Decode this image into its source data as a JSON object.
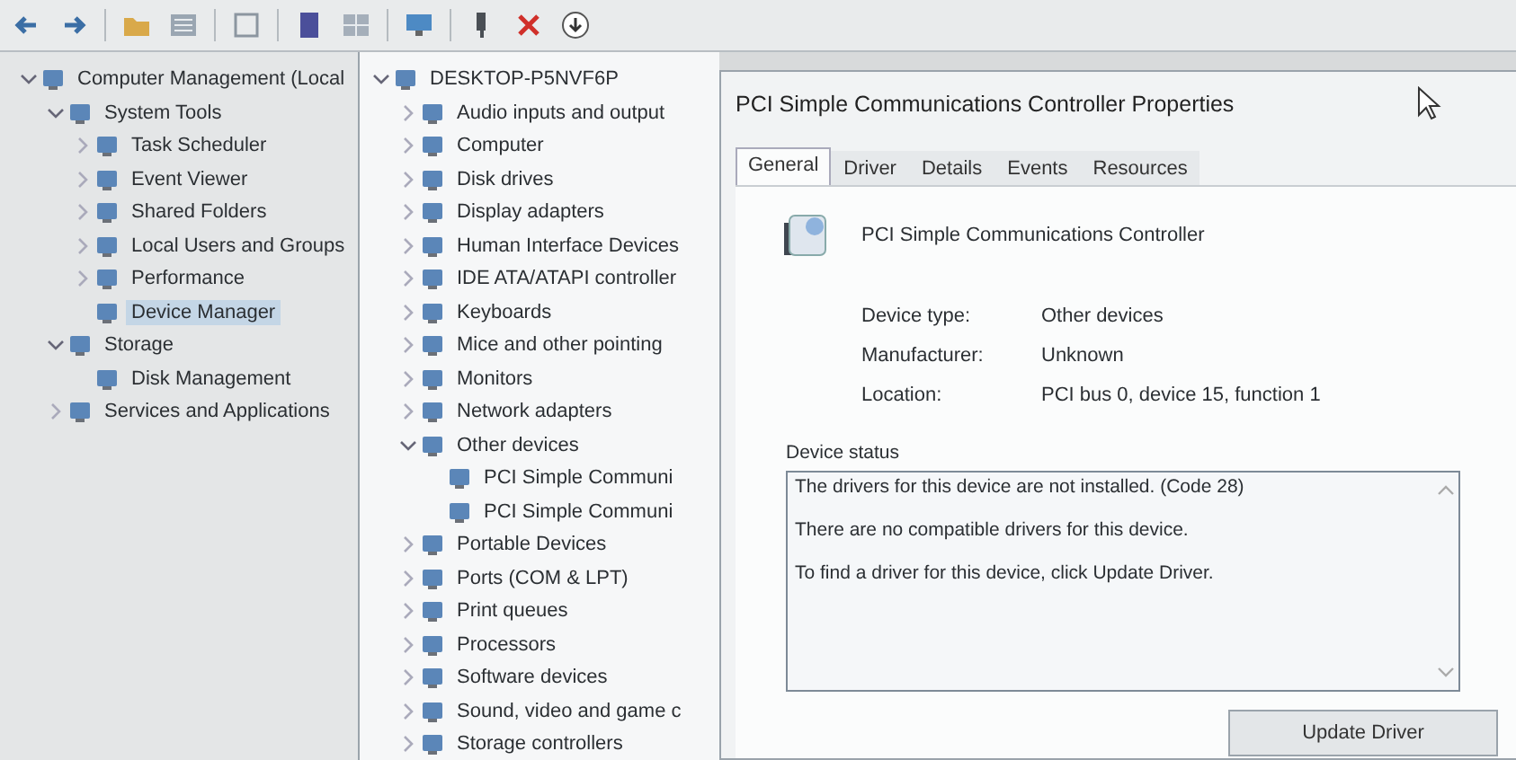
{
  "console_tree": [
    {
      "label": "Computer Management (Local",
      "selected": false,
      "expanded": true,
      "children": [
        {
          "label": "System Tools",
          "selected": false,
          "expanded": true,
          "children": [
            {
              "label": "Task Scheduler",
              "selected": false,
              "expanded": false
            },
            {
              "label": "Event Viewer",
              "selected": false,
              "expanded": false
            },
            {
              "label": "Shared Folders",
              "selected": false,
              "expanded": false
            },
            {
              "label": "Local Users and Groups",
              "selected": false,
              "expanded": false
            },
            {
              "label": "Performance",
              "selected": false,
              "expanded": false
            },
            {
              "label": "Device Manager",
              "selected": true
            }
          ]
        },
        {
          "label": "Storage",
          "selected": false,
          "expanded": true,
          "children": [
            {
              "label": "Disk Management",
              "selected": false
            }
          ]
        },
        {
          "label": "Services and Applications",
          "selected": false,
          "expanded": false
        }
      ]
    }
  ],
  "device_tree": [
    {
      "label": "DESKTOP-P5NVF6P",
      "selected": false,
      "expanded": true,
      "children": [
        {
          "label": "Audio inputs and output",
          "selected": false,
          "expanded": false
        },
        {
          "label": "Computer",
          "selected": false,
          "expanded": false
        },
        {
          "label": "Disk drives",
          "selected": false,
          "expanded": false
        },
        {
          "label": "Display adapters",
          "selected": false,
          "expanded": false
        },
        {
          "label": "Human Interface Devices",
          "selected": false,
          "expanded": false
        },
        {
          "label": "IDE ATA/ATAPI controller",
          "selected": false,
          "expanded": false
        },
        {
          "label": "Keyboards",
          "selected": false,
          "expanded": false
        },
        {
          "label": "Mice and other pointing",
          "selected": false,
          "expanded": false
        },
        {
          "label": "Monitors",
          "selected": false,
          "expanded": false
        },
        {
          "label": "Network adapters",
          "selected": false,
          "expanded": false
        },
        {
          "label": "Other devices",
          "selected": false,
          "expanded": true,
          "children": [
            {
              "label": "PCI Simple Communi",
              "selected": false
            },
            {
              "label": "PCI Simple Communi",
              "selected": false
            }
          ]
        },
        {
          "label": "Portable Devices",
          "selected": false,
          "expanded": false
        },
        {
          "label": "Ports (COM & LPT)",
          "selected": false,
          "expanded": false
        },
        {
          "label": "Print queues",
          "selected": false,
          "expanded": false
        },
        {
          "label": "Processors",
          "selected": false,
          "expanded": false
        },
        {
          "label": "Software devices",
          "selected": false,
          "expanded": false
        },
        {
          "label": "Sound, video and game c",
          "selected": false,
          "expanded": false
        },
        {
          "label": "Storage controllers",
          "selected": false,
          "expanded": false
        }
      ]
    }
  ],
  "dialog": {
    "title": "PCI Simple Communications Controller Properties",
    "tabs": [
      {
        "label": "General",
        "selected": true
      },
      {
        "label": "Driver",
        "selected": false
      },
      {
        "label": "Details",
        "selected": false
      },
      {
        "label": "Events",
        "selected": false
      },
      {
        "label": "Resources",
        "selected": false
      }
    ],
    "device_name": "PCI Simple Communications Controller",
    "properties": [
      {
        "label": "Device type:",
        "value": "Other devices"
      },
      {
        "label": "Manufacturer:",
        "value": "Unknown"
      },
      {
        "label": "Location:",
        "value": "PCI bus 0, device 15, function 1"
      }
    ],
    "status_group": "Device status",
    "status_lines": [
      "The drivers for this device are not installed. (Code 28)",
      "There are no compatible drivers for this device.",
      "To find a driver for this device, click Update Driver."
    ],
    "buttons": [
      "Update Driver"
    ]
  }
}
